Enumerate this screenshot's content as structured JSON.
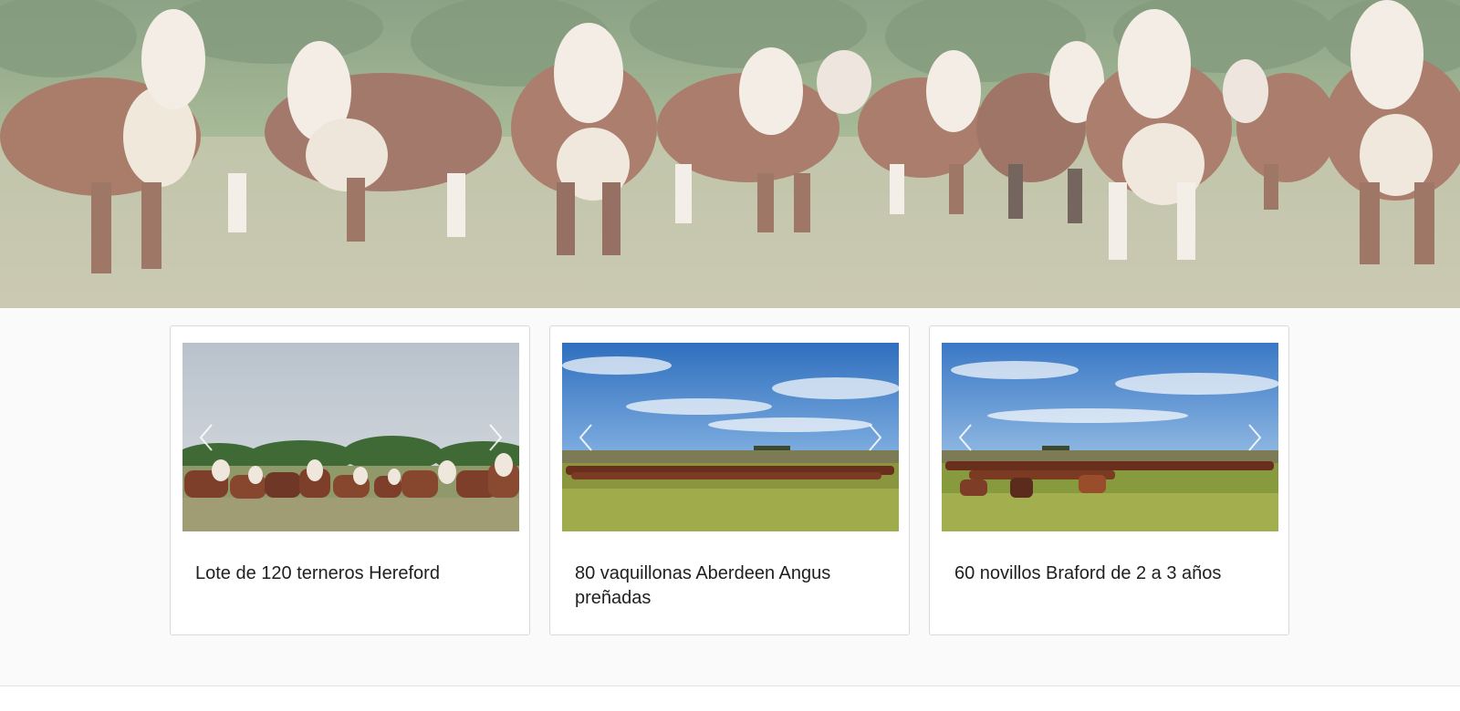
{
  "hero": {
    "image": "hereford-herd-photo",
    "alt_icon": "cattle-photo"
  },
  "listings": [
    {
      "title": "Lote de 120 terneros Hereford",
      "image": "hereford-calves-photo"
    },
    {
      "title": "80 vaquillonas Aberdeen Angus preñadas",
      "image": "angus-heifers-field-photo"
    },
    {
      "title": "60 novillos Braford de 2 a 3 años",
      "image": "braford-steers-field-photo"
    }
  ],
  "icons": {
    "prev": "chevron-left-icon",
    "next": "chevron-right-icon"
  },
  "colors": {
    "text": "#1f1f1f",
    "card_border": "#d9d9d9",
    "background": "#fafafb"
  }
}
